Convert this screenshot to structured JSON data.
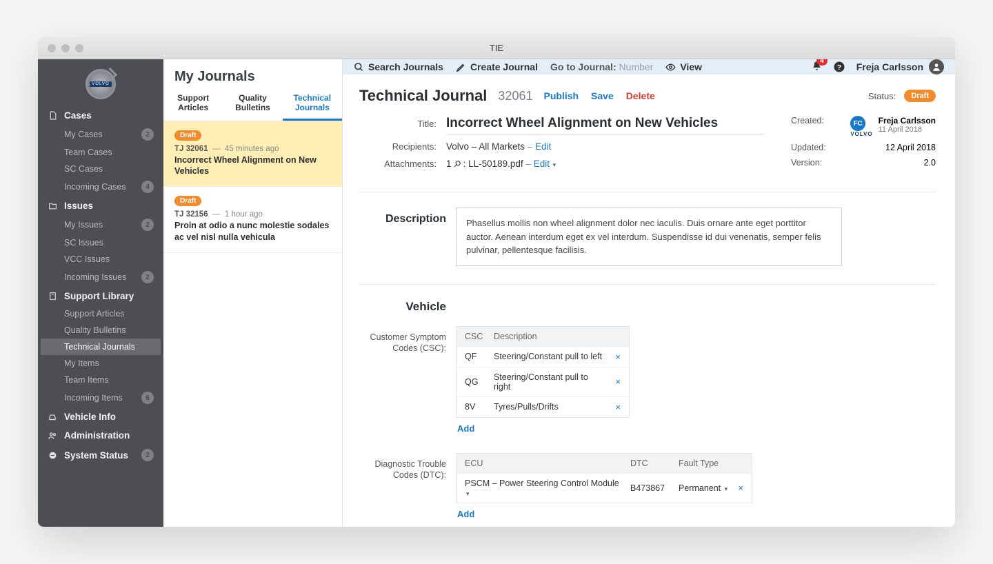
{
  "window_title": "TIE",
  "user_name": "Freja Carlsson",
  "notif_count": "4",
  "topbar": {
    "search": "Search Journals",
    "create": "Create Journal",
    "goto_label": "Go to Journal:",
    "goto_placeholder": "Number",
    "view": "View"
  },
  "sidebar": {
    "sections": [
      {
        "icon": "file",
        "label": "Cases",
        "items": [
          {
            "label": "My Cases",
            "badge": "2"
          },
          {
            "label": "Team Cases"
          },
          {
            "label": "SC Cases"
          },
          {
            "label": "Incoming Cases",
            "badge": "4"
          }
        ]
      },
      {
        "icon": "folder",
        "label": "Issues",
        "items": [
          {
            "label": "My Issues",
            "badge": "2"
          },
          {
            "label": "SC Issues"
          },
          {
            "label": "VCC Issues"
          },
          {
            "label": "Incoming Issues",
            "badge": "2"
          }
        ]
      },
      {
        "icon": "book",
        "label": "Support Library",
        "items": [
          {
            "label": "Support Articles"
          },
          {
            "label": "Quality Bulletins"
          },
          {
            "label": "Technical Journals",
            "active": true
          },
          {
            "label": "My Items"
          },
          {
            "label": "Team Items"
          },
          {
            "label": "Incoming Items",
            "badge": "6"
          }
        ]
      },
      {
        "icon": "car",
        "label": "Vehicle Info"
      },
      {
        "icon": "users",
        "label": "Administration"
      },
      {
        "icon": "minus",
        "label": "System Status",
        "badge": "2"
      }
    ]
  },
  "listcol": {
    "title": "My Journals",
    "tabs": [
      "Support Articles",
      "Quality Bulletins",
      "Technical Journals"
    ],
    "active_tab": 2,
    "items": [
      {
        "status": "Draft",
        "id": "TJ 32061",
        "time": "45 minutes ago",
        "title": "Incorrect Wheel Alignment on New Vehicles",
        "selected": true
      },
      {
        "status": "Draft",
        "id": "TJ 32156",
        "time": "1 hour ago",
        "title": "Proin at odio a nunc molestie sodales ac vel nisl nulla vehicula"
      }
    ]
  },
  "journal": {
    "heading": "Technical Journal",
    "number": "32061",
    "actions": {
      "publish": "Publish",
      "save": "Save",
      "delete": "Delete"
    },
    "status_label": "Status:",
    "status": "Draft",
    "title_label": "Title:",
    "title_value": "Incorrect Wheel Alignment on New Vehicles",
    "recipients_label": "Recipients:",
    "recipients_value": "Volvo – All Markets",
    "attachments_label": "Attachments:",
    "attachments_count": "1",
    "attachments_file": "LL-50189.pdf",
    "edit": "Edit",
    "created_label": "Created:",
    "created_name": "Freja Carlsson",
    "created_date": "11 April 2018",
    "created_brand": "VOLVO",
    "updated_label": "Updated:",
    "updated_value": "12 April 2018",
    "version_label": "Version:",
    "version_value": "2.0",
    "description_label": "Description",
    "description_text": "Phasellus mollis non wheel alignment dolor nec iaculis. Duis ornare ante eget porttitor auctor. Aenean interdum eget ex vel interdum. Suspendisse id dui venenatis, semper felis pulvinar, pellentesque facilisis.",
    "vehicle_label": "Vehicle",
    "csc": {
      "label": "Customer Symptom Codes (CSC):",
      "head": [
        "CSC",
        "Description"
      ],
      "rows": [
        {
          "code": "QF",
          "desc": "Steering/Constant pull to left"
        },
        {
          "code": "QG",
          "desc": "Steering/Constant pull to right"
        },
        {
          "code": "8V",
          "desc": "Tyres/Pulls/Drifts"
        }
      ],
      "add": "Add"
    },
    "dtc": {
      "label": "Diagnostic Trouble Codes (DTC):",
      "head": [
        "ECU",
        "DTC",
        "Fault Type"
      ],
      "rows": [
        {
          "ecu": "PSCM – Power Steering Control Module",
          "dtc": "B473867",
          "fault": "Permanent"
        }
      ],
      "add": "Add"
    }
  }
}
